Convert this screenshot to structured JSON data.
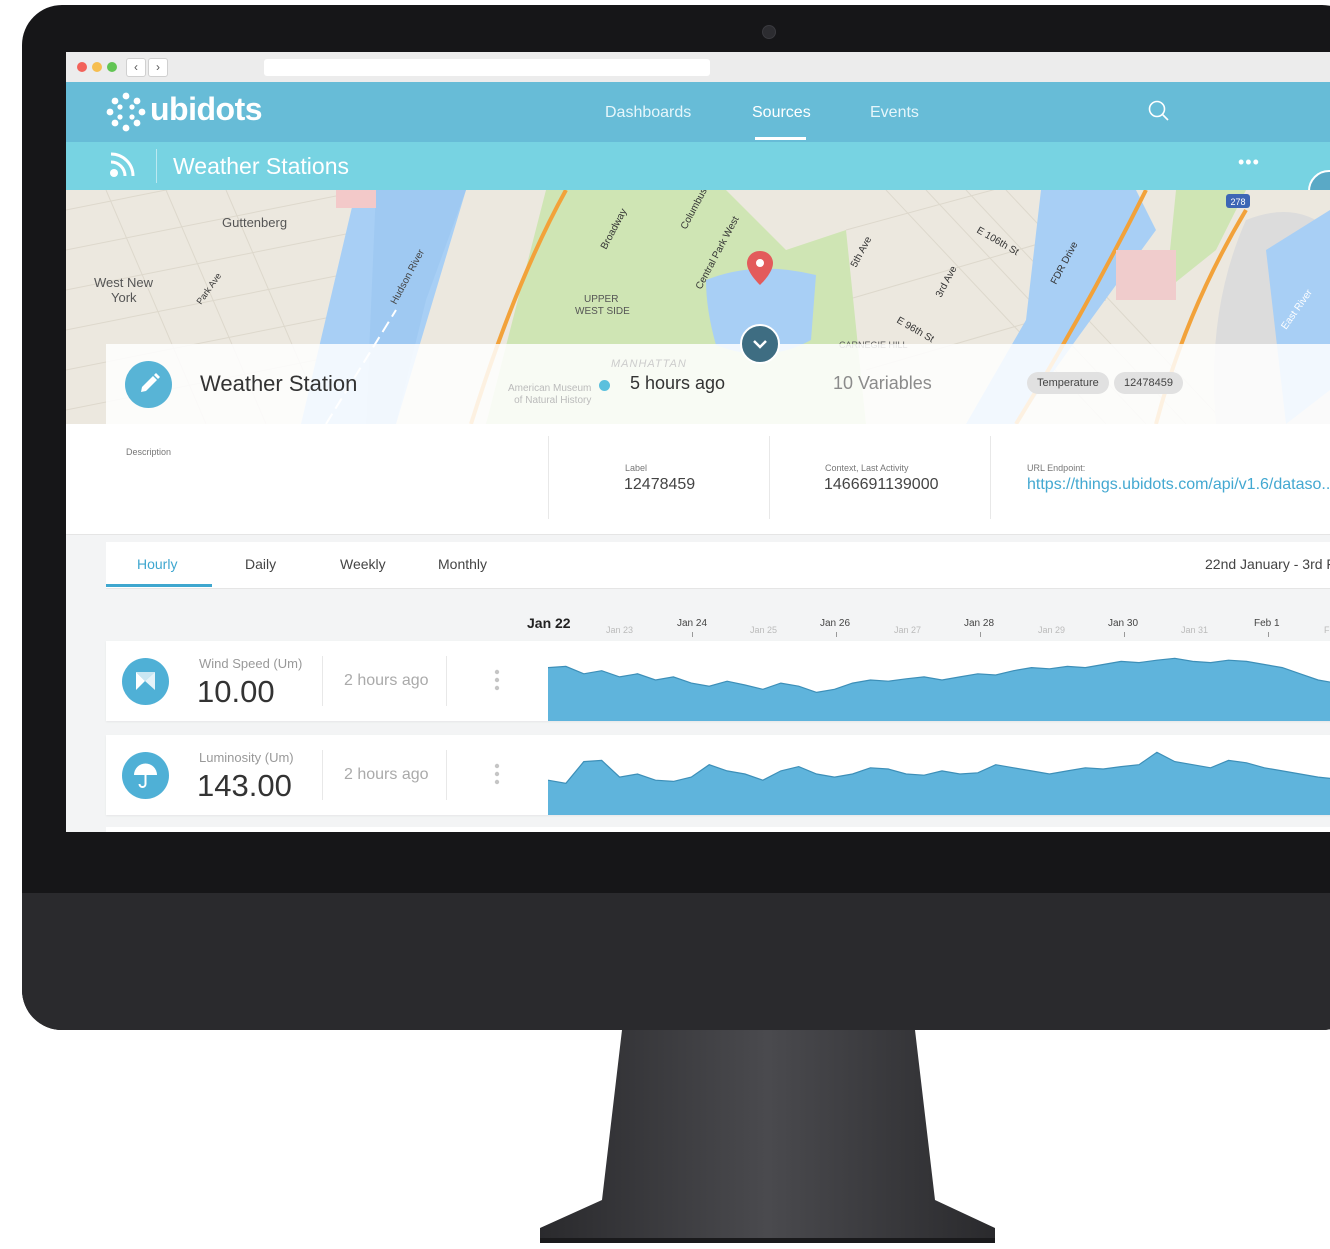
{
  "brand": {
    "name": "ubidots"
  },
  "nav": {
    "items": [
      {
        "label": "Dashboards"
      },
      {
        "label": "Sources",
        "active": true
      },
      {
        "label": "Events"
      }
    ]
  },
  "subheader": {
    "title": "Weather Stations",
    "more": "•••"
  },
  "map": {
    "labels": {
      "guttenberg": "Guttenberg",
      "west_new_york_1": "West New",
      "west_new_york_2": "York",
      "upper_west_1": "UPPER",
      "upper_west_2": "WEST SIDE",
      "manhattan": "MANHATTAN",
      "carnegie": "CARNEGIE HILL",
      "museum_1": "American Museum",
      "museum_2": "of Natural History",
      "hudson": "Hudson River",
      "broadway": "Broadway",
      "columbus": "Columbus",
      "cpw": "Central Park West",
      "fifth": "5th Ave",
      "third": "3rd Ave",
      "e106": "E 106th St",
      "e96": "E 96th St",
      "fdr": "FDR Drive",
      "east_river": "East River",
      "park_ave": "Park Ave",
      "shield": "278"
    }
  },
  "device": {
    "name": "Weather Station",
    "last_activity": "5 hours ago",
    "variables": "10 Variables",
    "tags": [
      "Temperature",
      "12478459"
    ]
  },
  "details": {
    "description_label": "Description",
    "label_label": "Label",
    "label_value": "12478459",
    "context_label": "Context, Last Activity",
    "context_value": "1466691139000",
    "url_label": "URL Endpoint:",
    "url_value": "https://things.ubidots.com/api/v1.6/dataso..."
  },
  "tabs": {
    "items": [
      "Hourly",
      "Daily",
      "Weekly",
      "Monthly"
    ],
    "active": "Hourly",
    "date_range": "22nd January - 3rd F"
  },
  "timeline": {
    "major": [
      "Jan 22",
      "Jan 24",
      "Jan 26",
      "Jan 28",
      "Jan 30",
      "Feb 1"
    ],
    "minor": [
      "Jan 23",
      "Jan 25",
      "Jan 27",
      "Jan 29",
      "Jan 31",
      "F"
    ]
  },
  "variables": [
    {
      "name": "Wind Speed (Um)",
      "value": "10.00",
      "ago": "2 hours ago",
      "icon": "windmill-icon",
      "series": [
        0.7,
        0.72,
        0.6,
        0.65,
        0.55,
        0.6,
        0.5,
        0.55,
        0.45,
        0.4,
        0.48,
        0.42,
        0.35,
        0.45,
        0.4,
        0.3,
        0.35,
        0.45,
        0.5,
        0.48,
        0.52,
        0.55,
        0.5,
        0.55,
        0.6,
        0.58,
        0.65,
        0.7,
        0.68,
        0.72,
        0.7,
        0.75,
        0.8,
        0.78,
        0.82,
        0.85,
        0.8,
        0.78,
        0.82,
        0.8,
        0.75,
        0.7,
        0.6,
        0.5,
        0.45
      ]
    },
    {
      "name": "Luminosity (Um)",
      "value": "143.00",
      "ago": "2 hours ago",
      "icon": "umbrella-icon",
      "series": [
        0.4,
        0.35,
        0.7,
        0.72,
        0.45,
        0.5,
        0.4,
        0.38,
        0.45,
        0.65,
        0.55,
        0.5,
        0.4,
        0.55,
        0.62,
        0.5,
        0.45,
        0.5,
        0.6,
        0.58,
        0.5,
        0.48,
        0.55,
        0.5,
        0.52,
        0.65,
        0.6,
        0.55,
        0.5,
        0.55,
        0.6,
        0.58,
        0.62,
        0.65,
        0.85,
        0.7,
        0.65,
        0.6,
        0.72,
        0.68,
        0.6,
        0.55,
        0.5,
        0.45,
        0.42
      ]
    }
  ]
}
